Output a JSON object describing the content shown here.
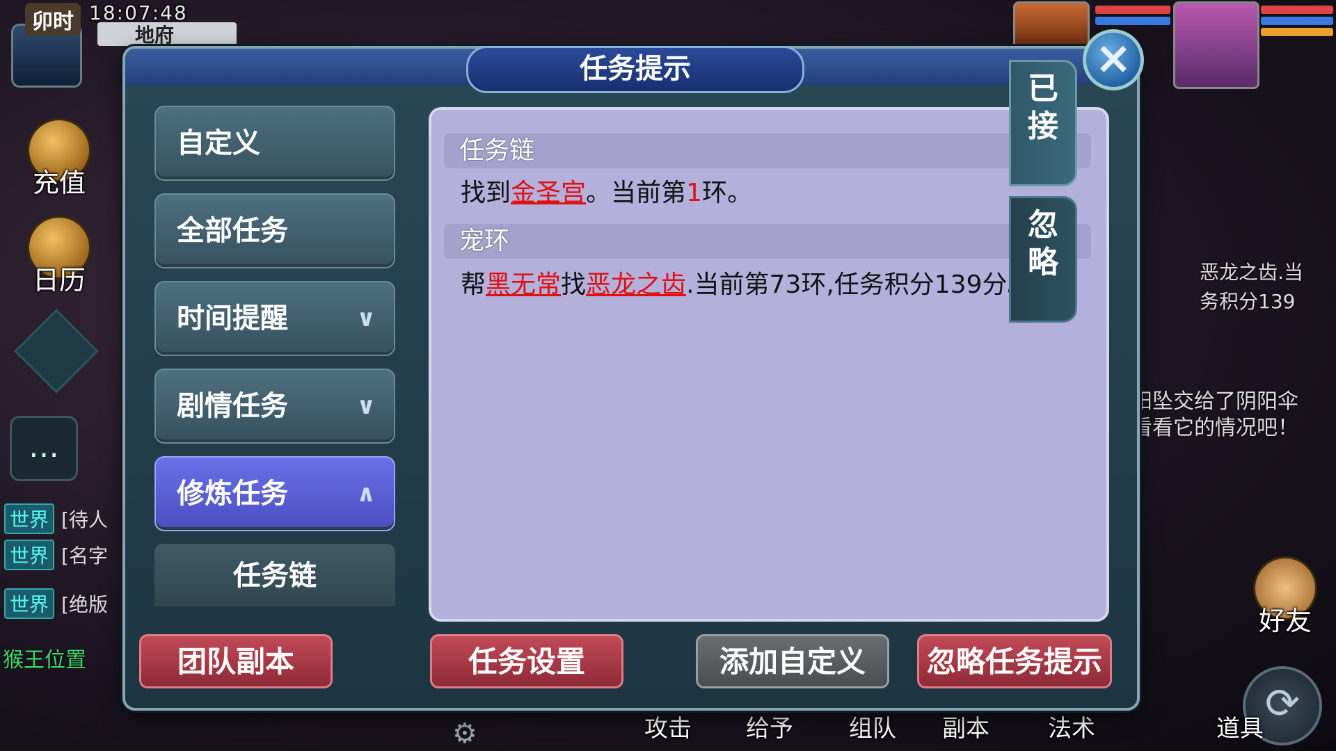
{
  "hud": {
    "shichen": "卯时",
    "time": "18:07:48",
    "location": "地府",
    "recharge_label": "充值",
    "calendar_label": "日历",
    "friend_label": "好友",
    "bottom_menu": [
      "攻击",
      "给予",
      "组队",
      "副本",
      "法术",
      "道具"
    ],
    "right_snippets": [
      "恶龙之齿.当",
      "务积分139",
      "阳坠交给了阴阳伞",
      "看看它的情况吧！"
    ],
    "monkey_label": "猴王位置"
  },
  "chat": [
    {
      "channel": "世界",
      "text": "[待人"
    },
    {
      "channel": "世界",
      "text": "[名字"
    },
    {
      "channel": "世界",
      "text": "[绝版"
    }
  ],
  "dialog": {
    "title": "任务提示",
    "close_icon": "close-x-icon",
    "categories": [
      {
        "label": "自定义",
        "chevron": ""
      },
      {
        "label": "全部任务",
        "chevron": ""
      },
      {
        "label": "时间提醒",
        "chevron": "∨"
      },
      {
        "label": "剧情任务",
        "chevron": "∨"
      },
      {
        "label": "修炼任务",
        "chevron": "∧"
      }
    ],
    "sub_item": "任务链",
    "tabs": {
      "accepted": "已接",
      "ignored": "忽略"
    },
    "sections": [
      {
        "header": "任务链",
        "body": {
          "p1": "找到",
          "link1": "金圣宫",
          "p2": "。当前第",
          "num": "1",
          "p3": "环。"
        }
      },
      {
        "header": "宠环",
        "body": {
          "p1": "帮",
          "link1": "黑无常",
          "p2": "找",
          "link2": "恶龙之齿",
          "p3": ".当前第73环,任务积分139分。"
        }
      }
    ],
    "buttons": {
      "team_dungeon": "团队副本",
      "task_settings": "任务设置",
      "add_custom": "添加自定义",
      "ignore_tips": "忽略任务提示"
    }
  }
}
